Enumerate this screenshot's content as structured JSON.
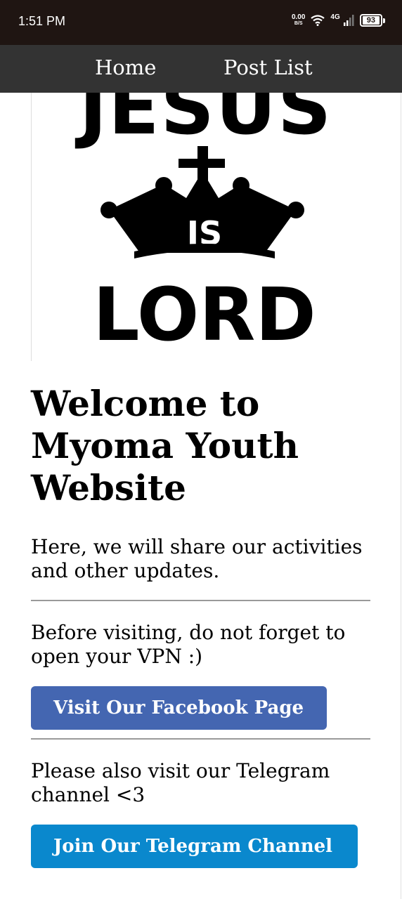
{
  "status_bar": {
    "time": "1:51 PM",
    "net_speed": "0.00",
    "net_speed_unit": "B/S",
    "network_type": "4G",
    "battery": "93"
  },
  "nav": {
    "items": [
      {
        "label": "Home"
      },
      {
        "label": "Post List"
      }
    ]
  },
  "hero": {
    "icon": "jesus-is-lord-crown-logo",
    "text": "JESUS IS LORD"
  },
  "main": {
    "title": "Welcome to Myoma Youth Website",
    "intro": "Here, we will share our activities and other updates.",
    "vpn_note": "Before visiting, do not forget to open your VPN :)",
    "facebook_button": "Visit Our Facebook Page",
    "telegram_note": "Please also visit our Telegram channel <3",
    "telegram_button": "Join Our Telegram Channel"
  },
  "colors": {
    "status_bar_bg": "#1f1512",
    "navbar_bg": "#333333",
    "facebook_button": "#4466b1",
    "telegram_button": "#0a88cd"
  }
}
